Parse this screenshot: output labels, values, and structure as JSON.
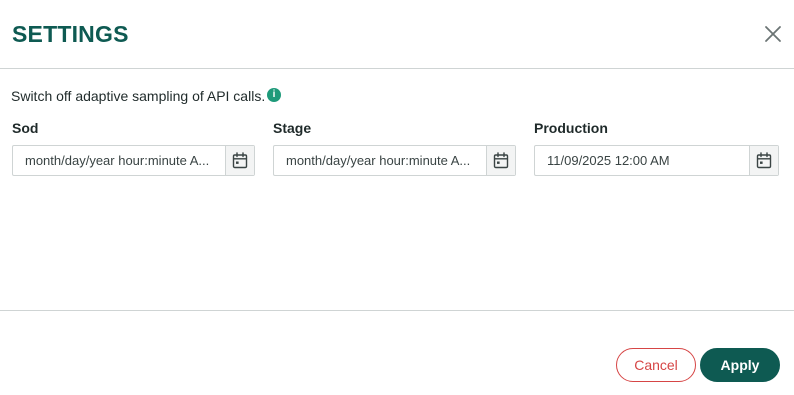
{
  "dialog": {
    "title": "SETTINGS",
    "close_icon": "close-icon"
  },
  "settings": {
    "description": "Switch off adaptive sampling of API calls.",
    "info_icon": "info-icon",
    "info_glyph": "i",
    "fields": [
      {
        "label": "Sod",
        "value": "",
        "placeholder": "month/day/year hour:minute A...",
        "icon": "calendar-icon"
      },
      {
        "label": "Stage",
        "value": "",
        "placeholder": "month/day/year hour:minute A...",
        "icon": "calendar-icon"
      },
      {
        "label": "Production",
        "value": "11/09/2025 12:00 AM",
        "placeholder": "",
        "icon": "calendar-icon"
      }
    ]
  },
  "footer": {
    "cancel_label": "Cancel",
    "apply_label": "Apply"
  },
  "colors": {
    "brand": "#0e5a52",
    "info": "#1e9a7a",
    "danger": "#d64545",
    "border": "#cfd4d4"
  }
}
